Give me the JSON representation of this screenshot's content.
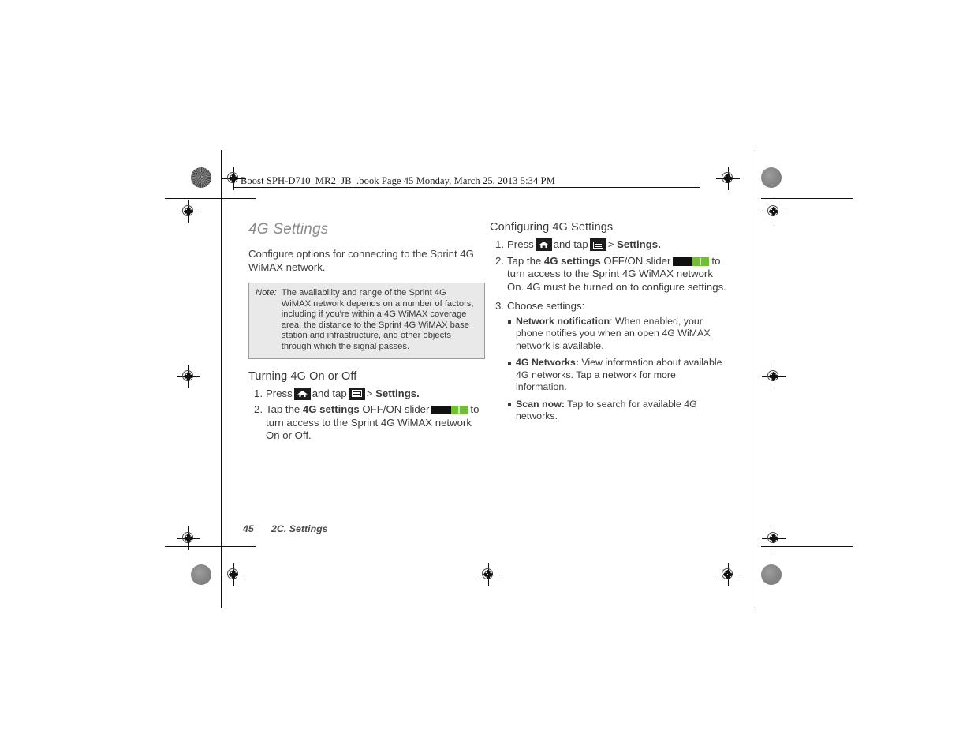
{
  "book_header": "Boost SPH-D710_MR2_JB_.book  Page 45  Monday, March 25, 2013  5:34 PM",
  "left_column": {
    "chapter_title": "4G Settings",
    "intro": "Configure options for connecting to the Sprint 4G WiMAX network.",
    "note": {
      "label": "Note:",
      "text": "The availability and range of the Sprint 4G WiMAX network depends on a number of factors, including if you're within a 4G WiMAX coverage area, the distance to the Sprint 4G WiMAX base station and infrastructure, and other objects through which the signal passes."
    },
    "section_title": "Turning 4G On or Off",
    "steps": [
      {
        "num": "1.",
        "pre": "Press",
        "mid": "and tap",
        "post": "> ",
        "bold_end": "Settings."
      },
      {
        "num": "2.",
        "pre": "Tap the ",
        "bold": "4G settings",
        "mid": " OFF/ON slider",
        "post": "to turn access to the Sprint 4G WiMAX network On or Off."
      }
    ]
  },
  "right_column": {
    "section_title": "Configuring 4G Settings",
    "steps": [
      {
        "num": "1.",
        "pre": "Press",
        "mid": "and tap",
        "post": "> ",
        "bold_end": "Settings."
      },
      {
        "num": "2.",
        "pre": "Tap the ",
        "bold": "4G settings",
        "mid": " OFF/ON slider",
        "post": "to turn access to the Sprint 4G WiMAX network On. 4G must be turned on to configure settings."
      },
      {
        "num": "3.",
        "pre": "Choose settings:"
      }
    ],
    "bullets": [
      {
        "term": "Network notification",
        "desc": ": When enabled, your phone notifies you when an open 4G WiMAX network is available."
      },
      {
        "term": "4G Networks:",
        "desc": " View information about available 4G networks. Tap a network for more information."
      },
      {
        "term": "Scan now:",
        "desc": " Tap to search for available 4G networks."
      }
    ]
  },
  "footer": {
    "page_number": "45",
    "section": "2C. Settings"
  },
  "colors": {
    "toggle_on": "#6fbe36",
    "toggle_off": "#111111",
    "note_background": "#e9e9e9",
    "chapter_title": "#8a8a8a"
  }
}
